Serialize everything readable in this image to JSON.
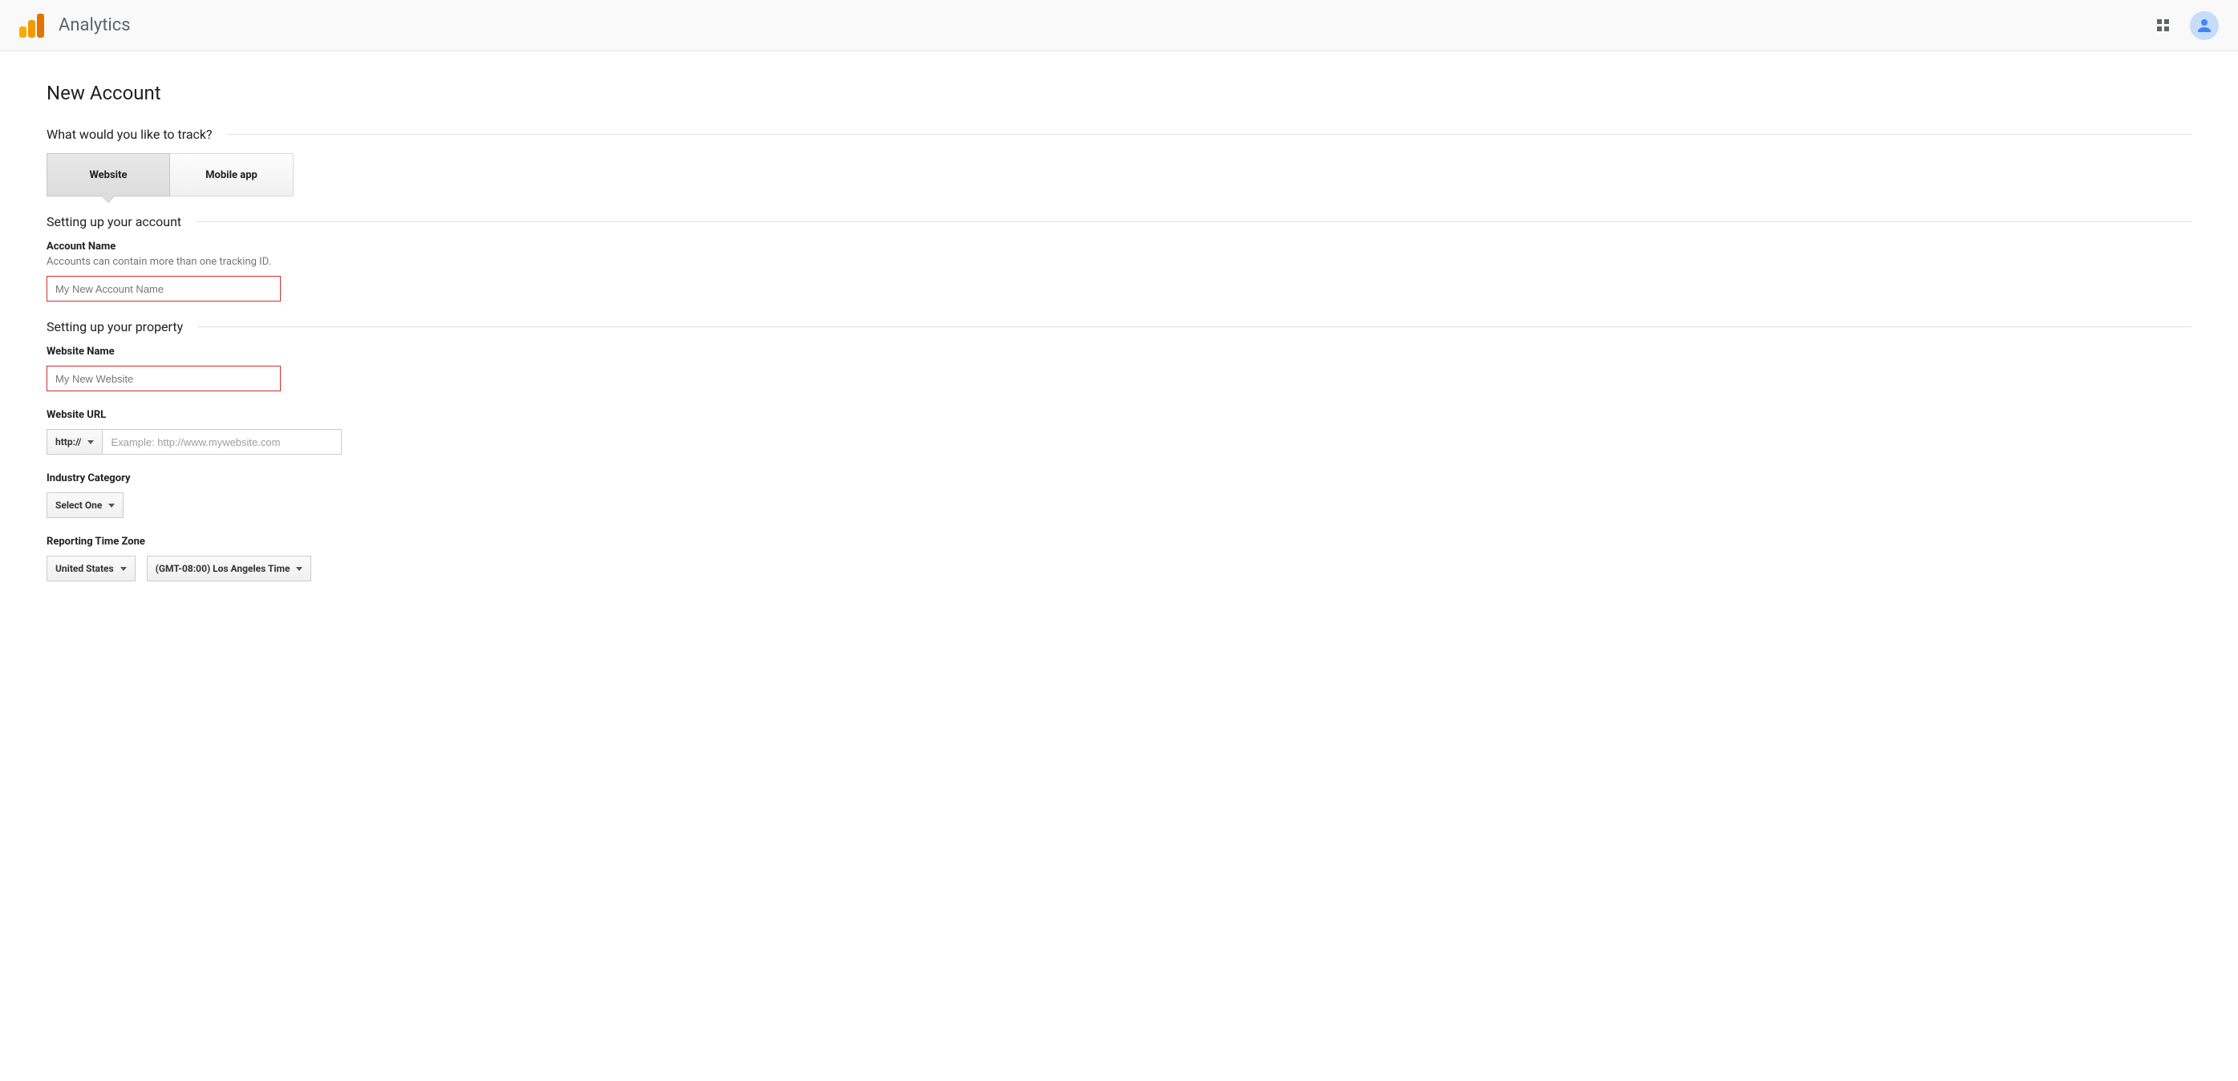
{
  "header": {
    "app_title": "Analytics"
  },
  "page": {
    "title": "New Account"
  },
  "track_section": {
    "heading": "What would you like to track?",
    "tab_website": "Website",
    "tab_mobile": "Mobile app"
  },
  "account_section": {
    "heading": "Setting up your account",
    "account_name_label": "Account Name",
    "account_name_desc": "Accounts can contain more than one tracking ID.",
    "account_name_placeholder": "My New Account Name"
  },
  "property_section": {
    "heading": "Setting up your property",
    "website_name_label": "Website Name",
    "website_name_placeholder": "My New Website",
    "website_url_label": "Website URL",
    "protocol_selected": "http://",
    "website_url_placeholder": "Example: http://www.mywebsite.com",
    "industry_label": "Industry Category",
    "industry_selected": "Select One",
    "timezone_label": "Reporting Time Zone",
    "tz_country_selected": "United States",
    "tz_value_selected": "(GMT-08:00) Los Angeles Time"
  }
}
